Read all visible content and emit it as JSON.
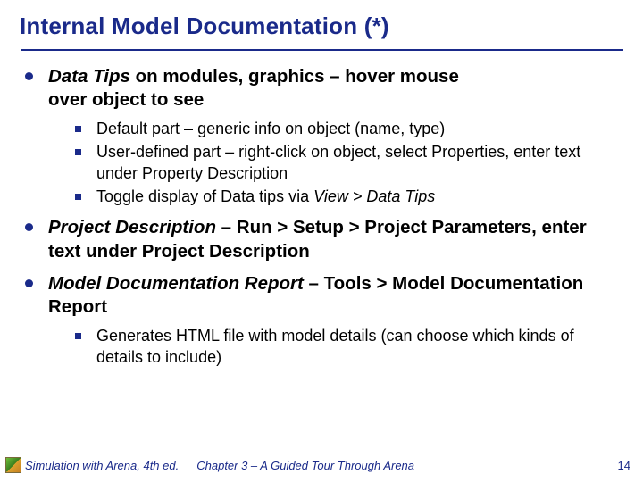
{
  "title": "Internal Model Documentation (*)",
  "bullets": {
    "b1": {
      "lead": "Data Tips",
      "rest1": " on modules, graphics – hover mouse",
      "rest2": "over object to see",
      "sub": [
        "Default part – generic info on object (name, type)",
        "User-defined part – right-click on object, select Properties, enter text under Property Description"
      ],
      "sub3_prefix": "Toggle display of Data tips via ",
      "sub3_italic": "View > Data Tips"
    },
    "b2": {
      "lead": "Project Description",
      "mid_bold": " – Run > Setup > Project Parameters,",
      "tail": " enter text under Project Description"
    },
    "b3": {
      "lead": "Model Documentation Report",
      "mid_bold": " – Tools > Model Documentation Report",
      "sub": [
        "Generates HTML file with model details (can choose which kinds of details to include)"
      ]
    }
  },
  "footer": {
    "left": "Simulation with Arena, 4th ed.",
    "center": "Chapter 3 – A Guided Tour Through Arena",
    "page": "14"
  }
}
